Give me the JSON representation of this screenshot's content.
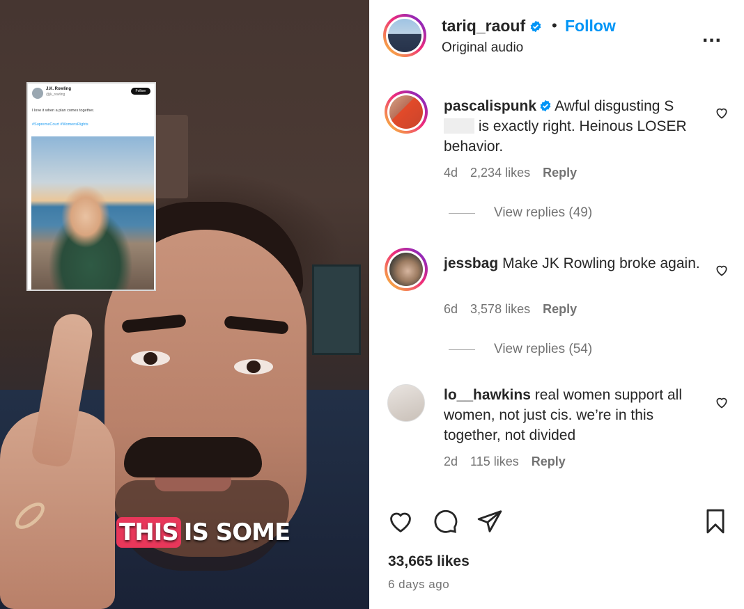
{
  "video": {
    "caption_highlight": "THIS",
    "caption_rest": "IS SOME",
    "embedded_tweet": {
      "name": "J.K. Rowling",
      "handle": "@jk_rowling",
      "follow_label": "Follow",
      "text": "I love it when a plan comes together.",
      "tags": "#SupremeCourt #WomensRights"
    }
  },
  "post": {
    "username": "tariq_raouf",
    "verified": true,
    "follow_label": "Follow",
    "separator": "•",
    "audio": "Original audio",
    "more": "..."
  },
  "comments": [
    {
      "username": "pascalispunk",
      "verified": true,
      "text_part1": "Awful disgusting S",
      "text_part2": "is exactly right. Heinous LOSER behavior.",
      "age": "4d",
      "likes": "2,234 likes",
      "reply_label": "Reply",
      "view_replies": "View replies (49)"
    },
    {
      "username": "jessbag",
      "verified": false,
      "text": "Make JK Rowling broke again.",
      "age": "6d",
      "likes": "3,578 likes",
      "reply_label": "Reply",
      "view_replies": "View replies (54)"
    },
    {
      "username": "lo__hawkins",
      "verified": false,
      "text": "real women support all women, not just cis. we’re in this together, not divided",
      "age": "2d",
      "likes": "115 likes",
      "reply_label": "Reply"
    }
  ],
  "footer": {
    "likes": "33,665 likes",
    "time_ago": "6 days ago"
  },
  "icons": {
    "like": "heart-icon",
    "comment": "comment-icon",
    "share": "send-icon",
    "save": "bookmark-icon",
    "comment_like": "heart-icon"
  },
  "colors": {
    "follow": "#0095f6",
    "verified": "#0095f6",
    "caption_highlight": "#e8375a",
    "meta_text": "#737373"
  }
}
